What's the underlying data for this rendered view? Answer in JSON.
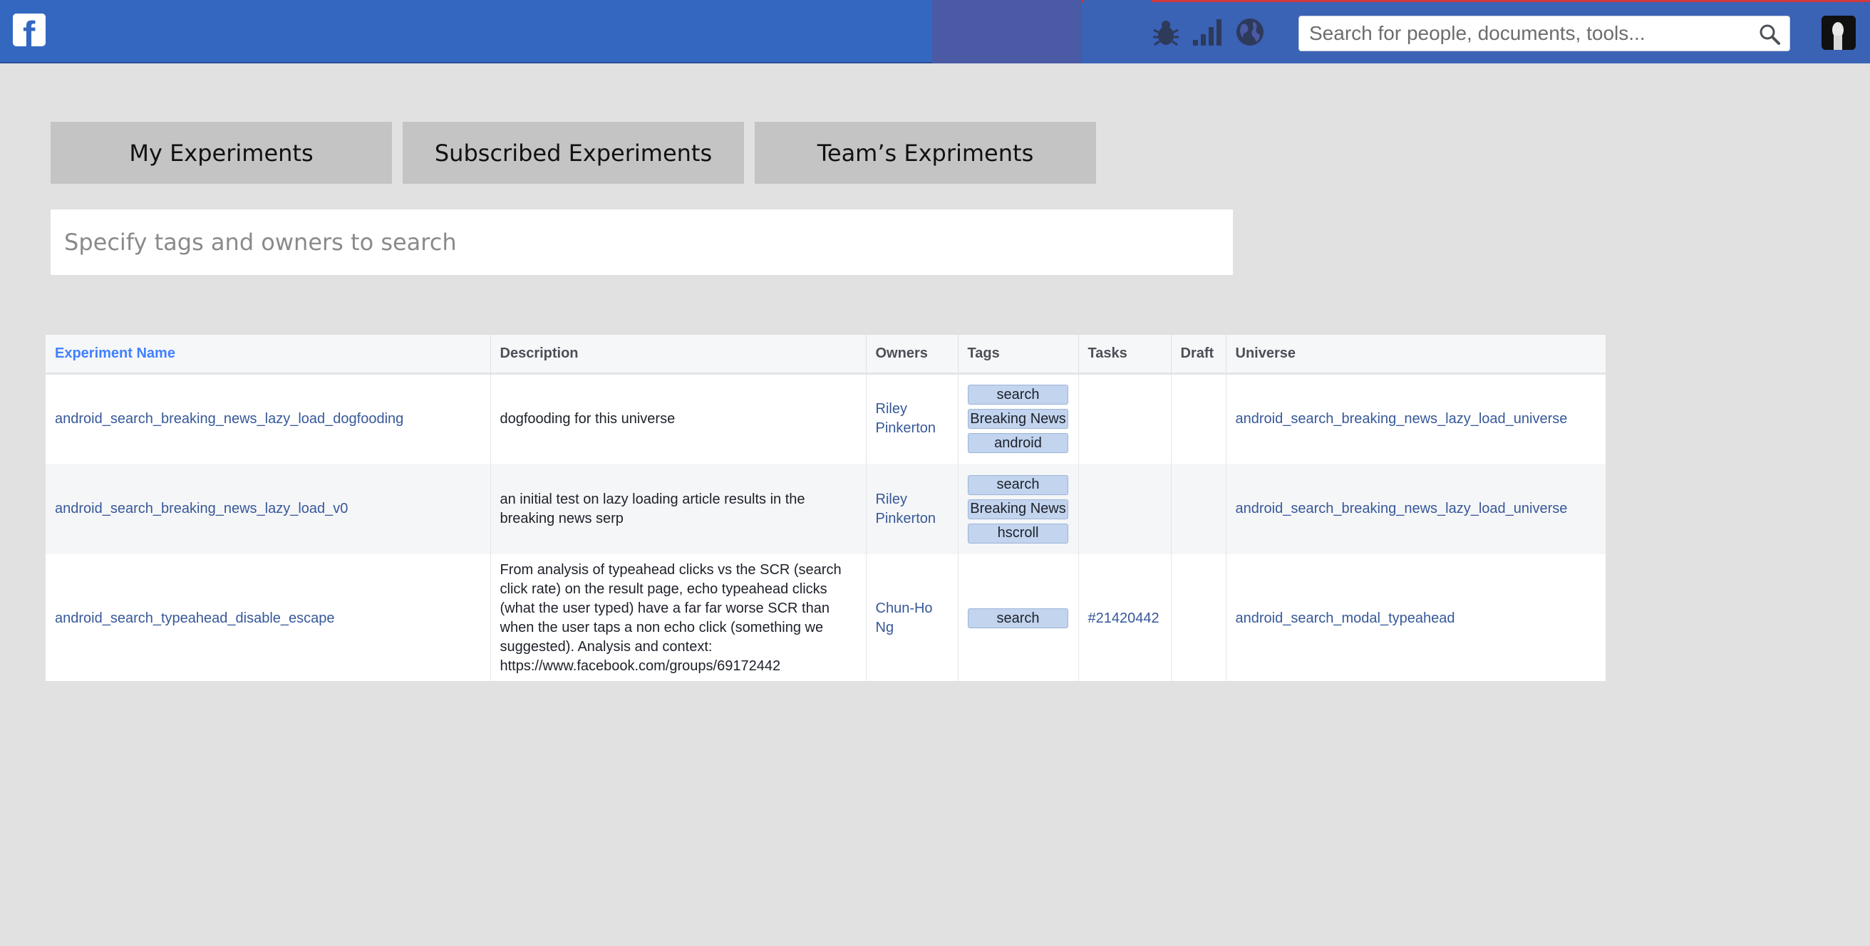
{
  "header": {
    "logo_letter": "f",
    "search_placeholder": "Search for people, documents, tools...",
    "icons": [
      "bug-icon",
      "signal-bars-icon",
      "globe-icon",
      "search-icon"
    ]
  },
  "tabs": [
    {
      "label": "My Experiments"
    },
    {
      "label": "Subscribed Experiments"
    },
    {
      "label": "Team’s Expriments"
    }
  ],
  "tag_search": {
    "placeholder": "Specify tags and owners to search"
  },
  "table": {
    "columns": [
      "Experiment Name",
      "Description",
      "Owners",
      "Tags",
      "Tasks",
      "Draft",
      "Universe"
    ],
    "rows": [
      {
        "name": "android_search_breaking_news_lazy_load_dogfooding",
        "description": "dogfooding for this universe",
        "owners": "Riley Pinkerton",
        "tags": [
          "search",
          "Breaking News",
          "android"
        ],
        "tasks": "",
        "draft": "",
        "universe": "android_search_breaking_news_lazy_load_universe"
      },
      {
        "name": "android_search_breaking_news_lazy_load_v0",
        "description": "an initial test on lazy loading article results in the breaking news serp",
        "owners": "Riley Pinkerton",
        "tags": [
          "search",
          "Breaking News",
          "hscroll"
        ],
        "tasks": "",
        "draft": "",
        "universe": "android_search_breaking_news_lazy_load_universe"
      },
      {
        "name": "android_search_typeahead_disable_escape",
        "description": "From analysis of typeahead clicks vs the SCR (search click rate) on the result page, echo typeahead clicks (what the user typed) have a far far worse SCR than when the user taps a non echo click (something we suggested). Analysis and context: https://www.facebook.com/groups/69172442",
        "owners": "Chun-Ho Ng",
        "tags": [
          "search"
        ],
        "tasks": "#21420442",
        "draft": "",
        "universe": "android_search_modal_typeahead"
      }
    ]
  },
  "colors": {
    "topbar": "#3468c0",
    "page_background": "#e1e1e1",
    "tab_background": "#c4c4c4",
    "link": "#365899",
    "sorted_header": "#4080ff",
    "tag_background": "#c2d4ee"
  }
}
